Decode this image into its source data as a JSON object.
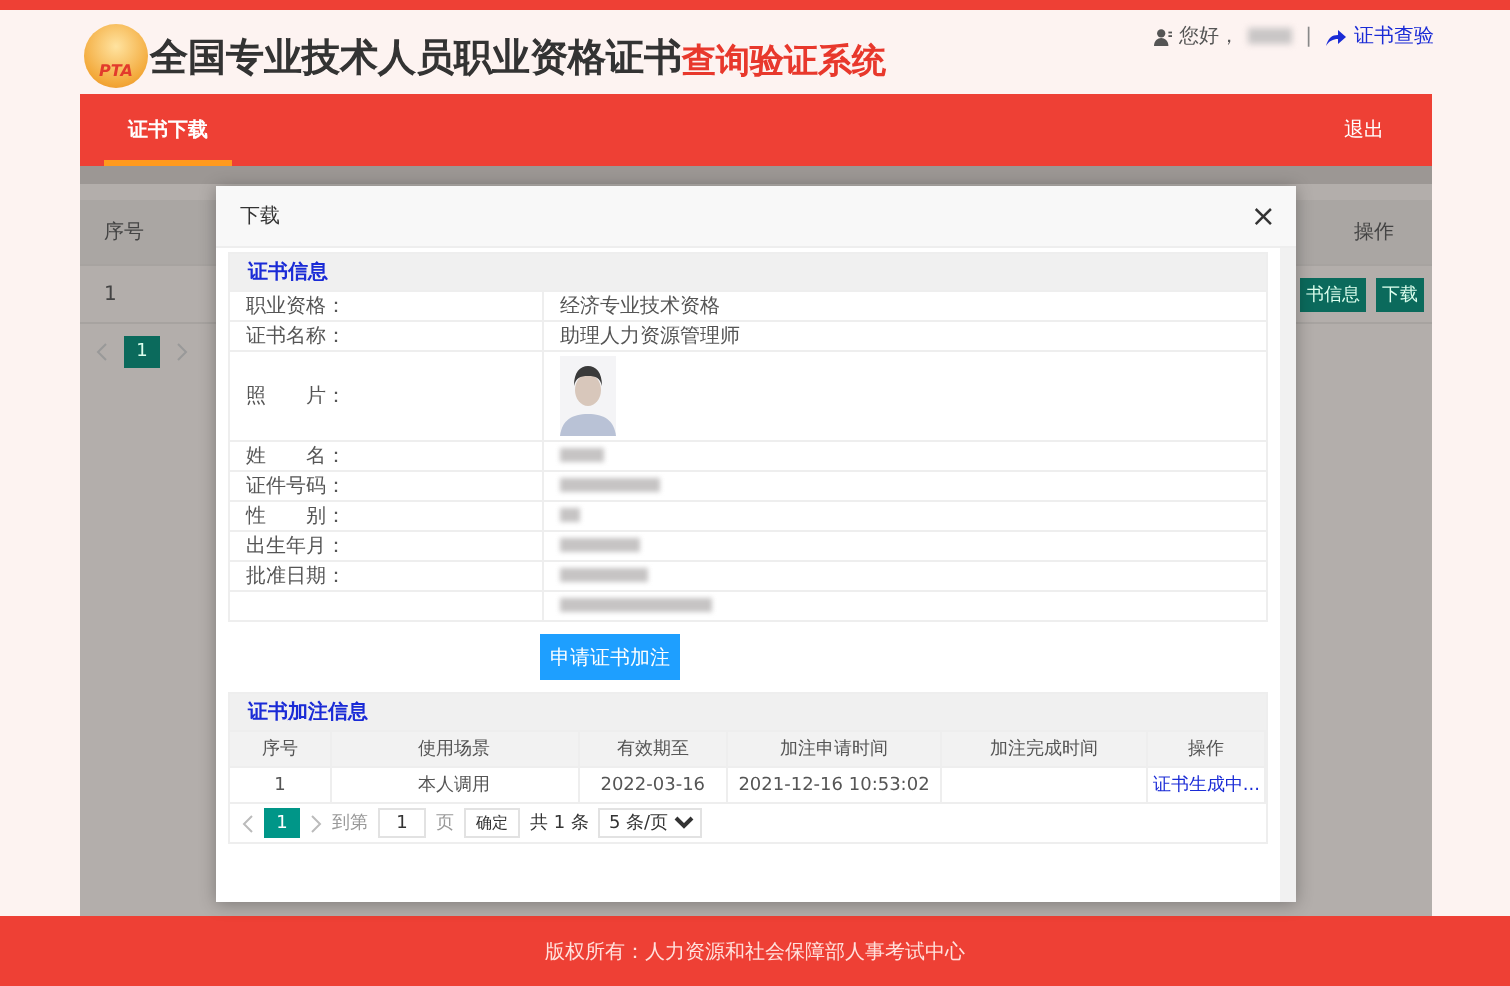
{
  "header": {
    "logo_text": "PTA",
    "title": "全国专业技术人员职业资格证书",
    "title_highlight": "查询验证系统",
    "greeting": "您好，",
    "separator": "|",
    "verify_link": "证书查验"
  },
  "nav": {
    "tabs": [
      {
        "label": "证书下载",
        "selected": true
      }
    ],
    "logout": "退出"
  },
  "background_table": {
    "columns": [
      "序号",
      "操作"
    ],
    "rows": [
      {
        "index": "1",
        "actions": [
          "书信息",
          "下载"
        ]
      }
    ],
    "pages": [
      {
        "label": "1",
        "selected": true
      }
    ]
  },
  "modal": {
    "title": "下载",
    "close": "×",
    "info": {
      "title": "证书信息",
      "rows": [
        {
          "label": "职业资格：",
          "kind": "text",
          "value": "经济专业技术资格"
        },
        {
          "label": "证书名称：",
          "kind": "text",
          "value": "助理人力资源管理师"
        },
        {
          "label": "照　　片："
        },
        {
          "label": "姓　　名：",
          "kind": "blurred"
        },
        {
          "label": "证件号码：",
          "kind": "blurred"
        },
        {
          "label": "性　　别：",
          "kind": "blurred"
        },
        {
          "label": "出生年月：",
          "kind": "blurred"
        },
        {
          "label": "批准日期：",
          "kind": "blurred"
        },
        {
          "kind": "blurred"
        }
      ]
    },
    "apply_button": "申请证书加注",
    "annotations": {
      "title": "证书加注信息",
      "columns": [
        "序号",
        "使用场景",
        "有效期至",
        "加注申请时间",
        "加注完成时间",
        "操作"
      ],
      "rows": [
        {
          "cells": [
            "1",
            "本人调用",
            "2022-03-16",
            "2021-12-16 10:53:02",
            ""
          ],
          "action": "证书生成中..."
        }
      ],
      "pagination": {
        "pages": [
          {
            "label": "1",
            "selected": true
          }
        ],
        "goto_label": "到第",
        "goto_value": "1",
        "page_unit": "页",
        "confirm": "确定",
        "total": "共 1 条",
        "page_size": "5 条/页"
      }
    }
  },
  "footer": {
    "copyright": "版权所有：人力资源和社会保障部人事考试中心"
  }
}
